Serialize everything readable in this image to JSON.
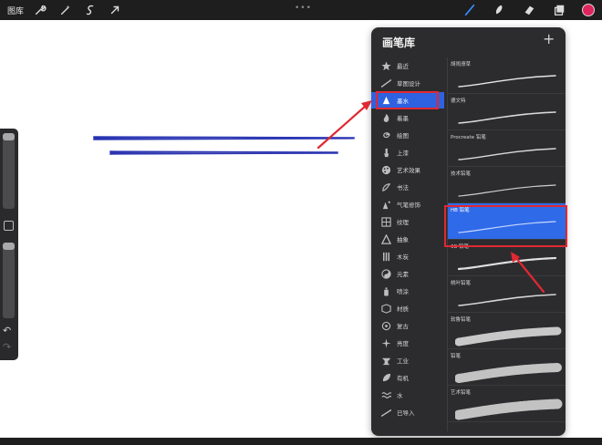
{
  "topbar": {
    "gallery_label": "图库",
    "icons": [
      "wrench-icon",
      "magic-wand-icon",
      "selection-icon",
      "transform-arrow-icon"
    ],
    "more_icon": "•••",
    "tools": [
      "brush-icon",
      "smudge-icon",
      "eraser-icon",
      "layers-icon"
    ],
    "current_color": "#e0245e"
  },
  "sidebar": {
    "undo": "↶",
    "redo": "↷"
  },
  "panel": {
    "title": "画笔库",
    "add": "+",
    "categories": [
      {
        "label": "最近",
        "icon": "star-icon"
      },
      {
        "label": "草图设计",
        "icon": "sketch-icon"
      },
      {
        "label": "墨水",
        "icon": "ink-drop-icon"
      },
      {
        "label": "着墨",
        "icon": "flame-icon"
      },
      {
        "label": "绘图",
        "icon": "spiral-icon"
      },
      {
        "label": "上漆",
        "icon": "paint-brush-icon"
      },
      {
        "label": "艺术效果",
        "icon": "palette-icon"
      },
      {
        "label": "书法",
        "icon": "calligraphy-icon"
      },
      {
        "label": "气笔修饰",
        "icon": "airbrush-icon"
      },
      {
        "label": "纹理",
        "icon": "texture-icon"
      },
      {
        "label": "抽象",
        "icon": "triangle-icon"
      },
      {
        "label": "木炭",
        "icon": "charcoal-icon"
      },
      {
        "label": "元素",
        "icon": "yin-yang-icon"
      },
      {
        "label": "喷涂",
        "icon": "spray-can-icon"
      },
      {
        "label": "材质",
        "icon": "material-icon"
      },
      {
        "label": "复古",
        "icon": "retro-icon"
      },
      {
        "label": "亮度",
        "icon": "sparkle-icon"
      },
      {
        "label": "工业",
        "icon": "anvil-icon"
      },
      {
        "label": "有机",
        "icon": "leaf-icon"
      },
      {
        "label": "水",
        "icon": "water-wave-icon"
      },
      {
        "label": "已导入",
        "icon": "import-icon"
      }
    ],
    "selected_category": "墨水",
    "brushes": [
      {
        "label": "胡闹潦草"
      },
      {
        "label": "德文特"
      },
      {
        "label": "Procreate 铅笔"
      },
      {
        "label": "技术铅笔"
      },
      {
        "label": "HB 铅笔"
      },
      {
        "label": "6B 铅笔"
      },
      {
        "label": "桃叶铅笔"
      },
      {
        "label": "软鲁铅笔"
      },
      {
        "label": "铅笔"
      },
      {
        "label": "艺术铅笔"
      }
    ],
    "selected_brush": "HB 铅笔"
  },
  "canvas": {
    "stroke_colors": {
      "blue": "#2a34b4",
      "magenta": "#c0265e",
      "pink": "#d6758f"
    }
  },
  "highlight_color": "#e02832"
}
